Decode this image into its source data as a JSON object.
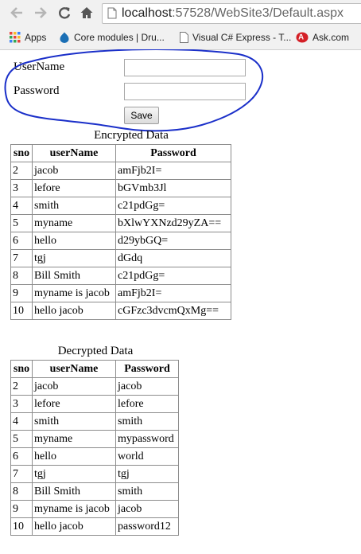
{
  "browser": {
    "url_host": "localhost",
    "url_path": ":57528/WebSite3/Default.aspx",
    "bookmarks": [
      {
        "label": "Apps",
        "icon": "apps-grid-icon"
      },
      {
        "label": "Core modules | Dru...",
        "icon": "drupal-icon"
      },
      {
        "label": "Visual C# Express - T...",
        "icon": "page-icon"
      },
      {
        "label": "Ask.com",
        "icon": "ask-icon"
      }
    ]
  },
  "form": {
    "username_label": "UserName",
    "password_label": "Password",
    "username_value": "",
    "password_value": "",
    "save_label": "Save"
  },
  "encrypted": {
    "caption": "Encrypted Data",
    "headers": [
      "sno",
      "userName",
      "Password"
    ],
    "rows": [
      [
        "2",
        "jacob",
        "amFjb2I="
      ],
      [
        "3",
        "lefore",
        "bGVmb3Jl"
      ],
      [
        "4",
        "smith",
        "c21pdGg="
      ],
      [
        "5",
        "myname",
        "bXlwYXNzd29yZA=="
      ],
      [
        "6",
        "hello",
        "d29ybGQ="
      ],
      [
        "7",
        "tgj",
        "dGdq"
      ],
      [
        "8",
        "Bill Smith",
        "c21pdGg="
      ],
      [
        "9",
        "myname is jacob",
        "amFjb2I="
      ],
      [
        "10",
        "hello jacob",
        "cGFzc3dvcmQxMg=="
      ]
    ]
  },
  "decrypted": {
    "caption": "Decrypted Data",
    "headers": [
      "sno",
      "userName",
      "Password"
    ],
    "rows": [
      [
        "2",
        "jacob",
        "jacob"
      ],
      [
        "3",
        "lefore",
        "lefore"
      ],
      [
        "4",
        "smith",
        "smith"
      ],
      [
        "5",
        "myname",
        "mypassword"
      ],
      [
        "6",
        "hello",
        "world"
      ],
      [
        "7",
        "tgj",
        "tgj"
      ],
      [
        "8",
        "Bill Smith",
        "smith"
      ],
      [
        "9",
        "myname is jacob",
        "jacob"
      ],
      [
        "10",
        "hello jacob",
        "password12"
      ]
    ]
  },
  "colors": {
    "annotation": "#1a2fc9"
  }
}
